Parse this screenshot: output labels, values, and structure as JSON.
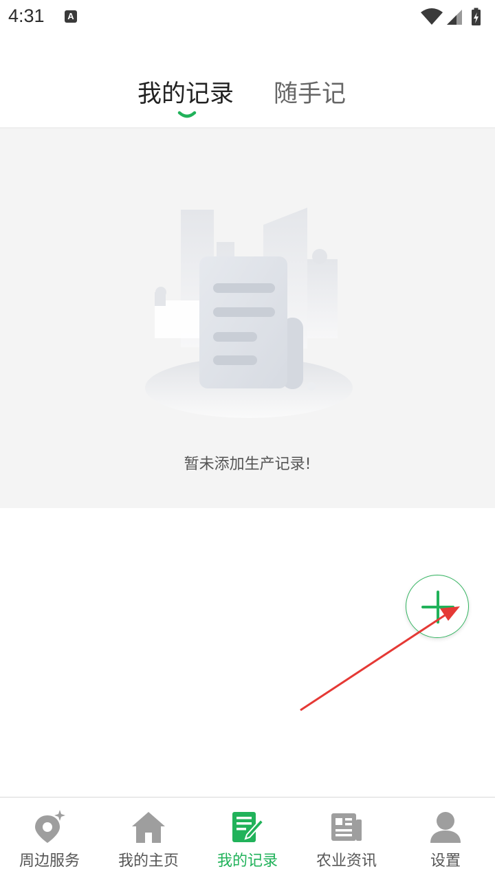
{
  "status_bar": {
    "time": "4:31",
    "notification_icon": "a-icon"
  },
  "top_tabs": [
    {
      "label": "我的记录",
      "active": true
    },
    {
      "label": "随手记",
      "active": false
    }
  ],
  "empty_state": {
    "message": "暂未添加生产记录!",
    "icon": "empty-document-icon"
  },
  "fab": {
    "icon": "plus-icon"
  },
  "bottom_nav": [
    {
      "label": "周边服务",
      "icon": "location-sparkle-icon",
      "active": false
    },
    {
      "label": "我的主页",
      "icon": "home-icon",
      "active": false
    },
    {
      "label": "我的记录",
      "icon": "note-edit-icon",
      "active": true
    },
    {
      "label": "农业资讯",
      "icon": "news-icon",
      "active": false
    },
    {
      "label": "设置",
      "icon": "user-icon",
      "active": false
    }
  ],
  "colors": {
    "accent": "#21b25a",
    "inactive": "#9e9e9e",
    "annotation_arrow": "#e53935"
  }
}
